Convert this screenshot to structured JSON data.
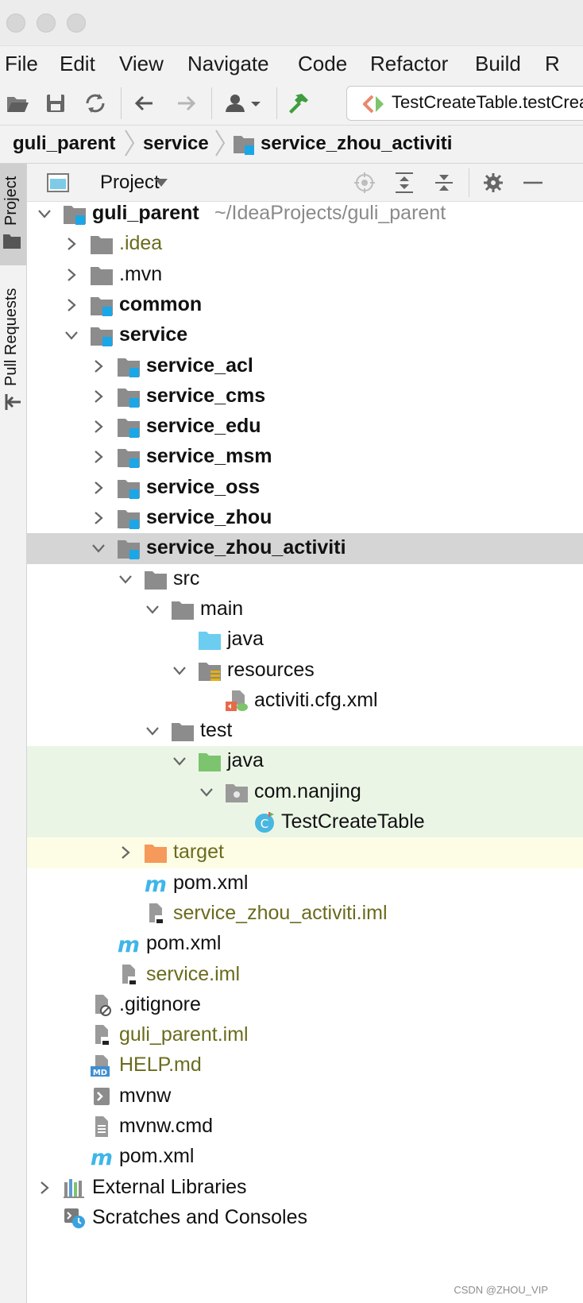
{
  "menubar": {
    "items": [
      "File",
      "Edit",
      "View",
      "Navigate",
      "Code",
      "Refactor",
      "Build",
      "R"
    ]
  },
  "toolbar": {
    "run_config_label": "TestCreateTable.testCrea",
    "icons": [
      "open-folder-icon",
      "save-icon",
      "sync-icon",
      "back-arrow-icon",
      "forward-arrow-icon",
      "user-dropdown-icon",
      "build-hammer-icon"
    ]
  },
  "breadcrumb": {
    "items": [
      "guli_parent",
      "service",
      "service_zhou_activiti"
    ]
  },
  "sidestrip": {
    "project_tab": "Project",
    "pull_requests_tab": "Pull Requests"
  },
  "project_panel": {
    "view_selector": "Project"
  },
  "tree": {
    "rows": [
      {
        "label": "guli_parent",
        "path": "~/IdeaProjects/guli_parent"
      },
      {
        "label": ".idea"
      },
      {
        "label": ".mvn"
      },
      {
        "label": "common"
      },
      {
        "label": "service"
      },
      {
        "label": "service_acl"
      },
      {
        "label": "service_cms"
      },
      {
        "label": "service_edu"
      },
      {
        "label": "service_msm"
      },
      {
        "label": "service_oss"
      },
      {
        "label": "service_zhou"
      },
      {
        "label": "service_zhou_activiti"
      },
      {
        "label": "src"
      },
      {
        "label": "main"
      },
      {
        "label": "java"
      },
      {
        "label": "resources"
      },
      {
        "label": "activiti.cfg.xml"
      },
      {
        "label": "test"
      },
      {
        "label": "java"
      },
      {
        "label": "com.nanjing"
      },
      {
        "label": "TestCreateTable"
      },
      {
        "label": "target"
      },
      {
        "label": "pom.xml"
      },
      {
        "label": "service_zhou_activiti.iml"
      },
      {
        "label": "pom.xml"
      },
      {
        "label": "service.iml"
      },
      {
        "label": ".gitignore"
      },
      {
        "label": "guli_parent.iml"
      },
      {
        "label": "HELP.md"
      },
      {
        "label": "mvnw"
      },
      {
        "label": "mvnw.cmd"
      },
      {
        "label": "pom.xml"
      },
      {
        "label": "External Libraries"
      },
      {
        "label": "Scratches and Consoles"
      }
    ]
  },
  "watermark": "CSDN @ZHOU_VIP",
  "colors": {
    "selection": "#d5d5d5",
    "test_sources": "#ebf5e6",
    "excluded": "#fdfde6",
    "module_marker": "#1aa7e8",
    "olive_text": "#6b6b1e",
    "maven_blue": "#3fb6e8"
  }
}
